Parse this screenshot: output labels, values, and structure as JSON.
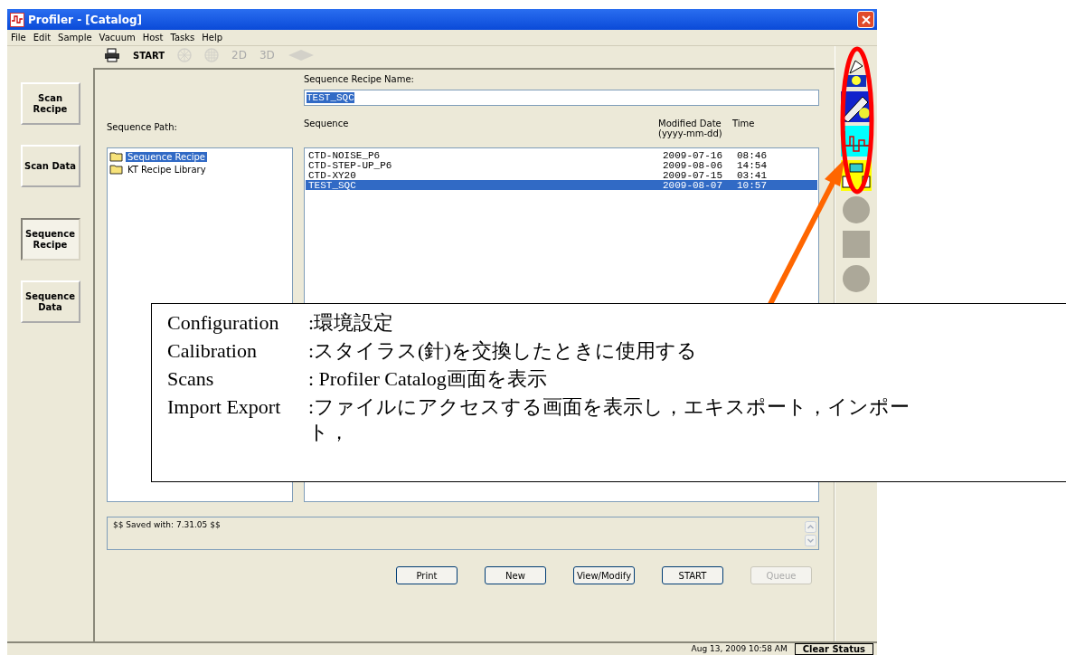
{
  "window": {
    "title": "Profiler - [Catalog]"
  },
  "menu": [
    "File",
    "Edit",
    "Sample",
    "Vacuum",
    "Host",
    "Tasks",
    "Help"
  ],
  "toolbar": [
    {
      "kind": "printer",
      "disabled": false
    },
    {
      "kind": "text",
      "label": "START",
      "disabled": false
    },
    {
      "kind": "wheel",
      "disabled": true
    },
    {
      "kind": "globe",
      "disabled": true
    },
    {
      "kind": "text",
      "label": "2D",
      "disabled": true
    },
    {
      "kind": "text",
      "label": "3D",
      "disabled": true
    },
    {
      "kind": "diamond",
      "disabled": true
    }
  ],
  "nav": [
    {
      "label": "Scan Recipe",
      "selected": false
    },
    {
      "label": "Scan Data",
      "selected": false
    },
    {
      "label": "Sequence Recipe",
      "selected": true
    },
    {
      "label": "Sequence Data",
      "selected": false
    }
  ],
  "recipe_name": {
    "label": "Sequence Recipe Name:",
    "value": "TEST_SQC",
    "text_selected": true
  },
  "path": {
    "label": "Sequence Path:",
    "items": [
      {
        "label": "Sequence Recipe",
        "selected": true
      },
      {
        "label": "KT Recipe Library",
        "selected": false
      }
    ]
  },
  "sequence": {
    "columns": [
      "Sequence",
      "Modified Date",
      "(yyyy-mm-dd)",
      "Time"
    ],
    "rows": [
      {
        "name": "CTD-NOISE_P6",
        "date": "2009-07-16",
        "time": "08:46",
        "selected": false
      },
      {
        "name": "CTD-STEP-UP_P6",
        "date": "2009-08-06",
        "time": "14:54",
        "selected": false
      },
      {
        "name": "CTD-XY20",
        "date": "2009-07-15",
        "time": "03:41",
        "selected": false
      },
      {
        "name": "TEST_SQC",
        "date": "2009-08-07",
        "time": "10:57",
        "selected": true
      }
    ]
  },
  "output": "$$ Saved with: 7.31.05 $$",
  "buttons": [
    {
      "label": "Print",
      "disabled": false
    },
    {
      "label": "New",
      "disabled": false
    },
    {
      "label": "View/Modify",
      "disabled": false
    },
    {
      "label": "START",
      "disabled": false
    },
    {
      "label": "Queue",
      "disabled": true
    }
  ],
  "side_tools": [
    {
      "kind": "configuration",
      "disabled": false
    },
    {
      "kind": "calibration",
      "disabled": false
    },
    {
      "kind": "scans",
      "disabled": false
    },
    {
      "kind": "import-export",
      "disabled": false
    },
    {
      "kind": "circle",
      "disabled": true
    },
    {
      "kind": "square",
      "disabled": true
    },
    {
      "kind": "circle",
      "disabled": true
    }
  ],
  "status_bar": {
    "datetime": "Aug 13, 2009 10:58 AM",
    "button": "Clear Status"
  },
  "callout": [
    {
      "term": "Configuration",
      "description": ":環境設定"
    },
    {
      "term": "Calibration",
      "description": ":スタイラス(針)を交換したときに使用する"
    },
    {
      "term": "Scans",
      "description": ": Profiler Catalog画面を表示"
    },
    {
      "term": "Import Export",
      "description": ":ファイルにアクセスする画面を表示し，エキスポート，インポート，"
    }
  ]
}
